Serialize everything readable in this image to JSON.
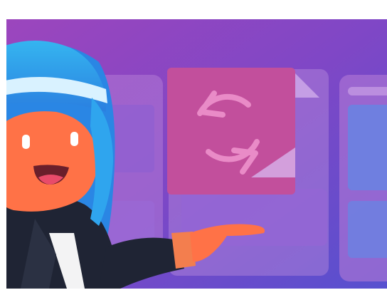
{
  "illustration": {
    "subject": "cartoon-woman-presenting-sync",
    "icons": [
      "sync-icon",
      "document-icon",
      "phone-icon"
    ]
  },
  "colors": {
    "background_top": "#9a4bc0",
    "background_bottom": "#5c4cd0",
    "hair": "#29a8e8",
    "skin": "#ff7247",
    "jacket": "#1e2433",
    "card": "#a56fd0",
    "sync_card": "#c24f9c",
    "screen_blue": "#6f7fe0",
    "cuff": "#f37e4e"
  }
}
